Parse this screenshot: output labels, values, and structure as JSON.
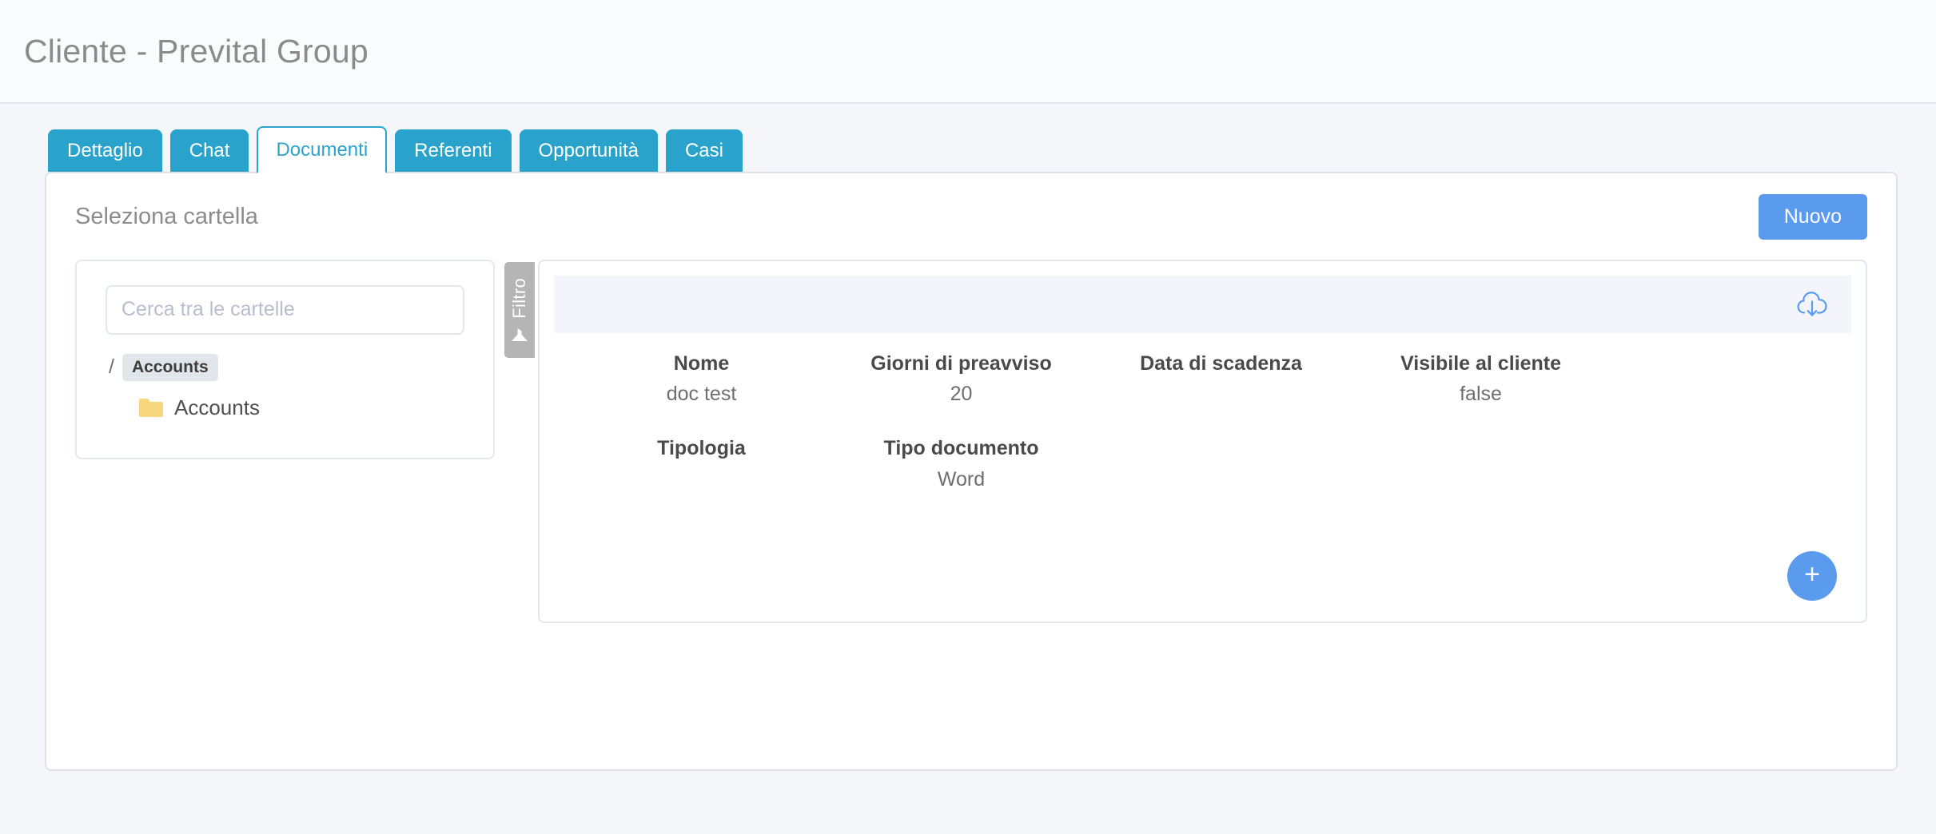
{
  "header": {
    "title": "Cliente - Prevital Group"
  },
  "tabs": [
    {
      "label": "Dettaglio",
      "active": false
    },
    {
      "label": "Chat",
      "active": false
    },
    {
      "label": "Documenti",
      "active": true
    },
    {
      "label": "Referenti",
      "active": false
    },
    {
      "label": "Opportunità",
      "active": false
    },
    {
      "label": "Casi",
      "active": false
    }
  ],
  "content": {
    "section_title": "Seleziona cartella",
    "new_button": "Nuovo",
    "folder_picker": {
      "search_placeholder": "Cerca tra le cartelle",
      "search_value": "",
      "breadcrumb_separator": "/",
      "breadcrumb_items": [
        "Accounts"
      ],
      "folders": [
        "Accounts"
      ]
    },
    "filter_tab": {
      "label": "Filtro",
      "icon": "funnel-icon"
    },
    "documents_panel": {
      "toolbar": {
        "download_icon": "cloud-download-icon"
      },
      "fields": [
        {
          "label": "Nome",
          "value": "doc test"
        },
        {
          "label": "Giorni di preavviso",
          "value": "20"
        },
        {
          "label": "Data di scadenza",
          "value": ""
        },
        {
          "label": "Visibile al cliente",
          "value": "false"
        },
        {
          "label": "Tipologia",
          "value": ""
        },
        {
          "label": "Tipo documento",
          "value": "Word"
        },
        {
          "label": "",
          "value": ""
        },
        {
          "label": "",
          "value": ""
        }
      ],
      "add_button": "+"
    }
  },
  "colors": {
    "tab_active_text": "#2ba4cc",
    "tab_bg": "#29a3cb",
    "primary_button": "#5b9bed",
    "folder_icon": "#f7d680",
    "filter_tab_bg": "#b5b5b5",
    "page_bg": "#f4f6f9"
  }
}
